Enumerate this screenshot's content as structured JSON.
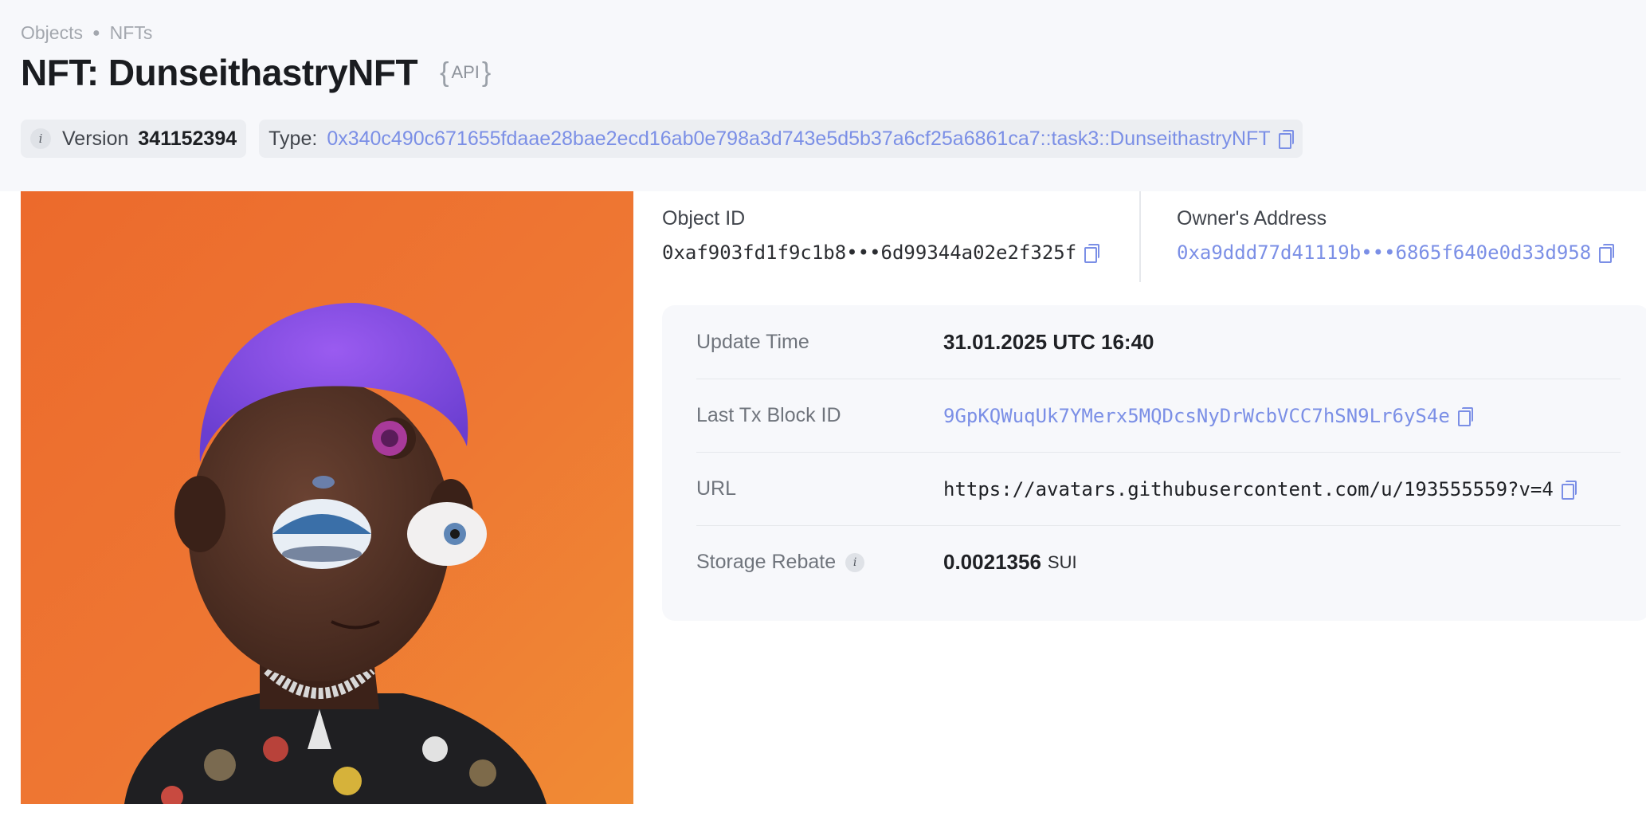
{
  "breadcrumb": {
    "items": [
      "Objects",
      "NFTs"
    ]
  },
  "header": {
    "title": "NFT: DunseithastryNFT",
    "api_badge": "API"
  },
  "meta": {
    "version_label": "Version",
    "version_value": "341152394",
    "type_label": "Type:",
    "type_value": "0x340c490c671655fdaae28bae2ecd16ab0e798a3d743e5d5b37a6cf25a6861ca7::task3::DunseithastryNFT"
  },
  "object": {
    "object_id_label": "Object ID",
    "object_id_value": "0xaf903fd1f9c1b8•••6d99344a02e2f325f",
    "owner_label": "Owner's Address",
    "owner_value": "0xa9ddd77d41119b•••6865f640e0d33d958"
  },
  "details": {
    "update_time_label": "Update Time",
    "update_time_value": "31.01.2025 UTC 16:40",
    "last_tx_label": "Last Tx Block ID",
    "last_tx_value": "9GpKQWuqUk7YMerx5MQDcsNyDrWcbVCC7hSN9Lr6yS4e",
    "url_label": "URL",
    "url_value": "https://avatars.githubusercontent.com/u/193555559?v=4",
    "storage_rebate_label": "Storage Rebate",
    "storage_rebate_value": "0.0021356",
    "storage_rebate_unit": "SUI"
  },
  "colors": {
    "link": "#7b8fe6",
    "image_background": "#ee7a35"
  },
  "icons": [
    "info-icon",
    "copy-icon"
  ]
}
